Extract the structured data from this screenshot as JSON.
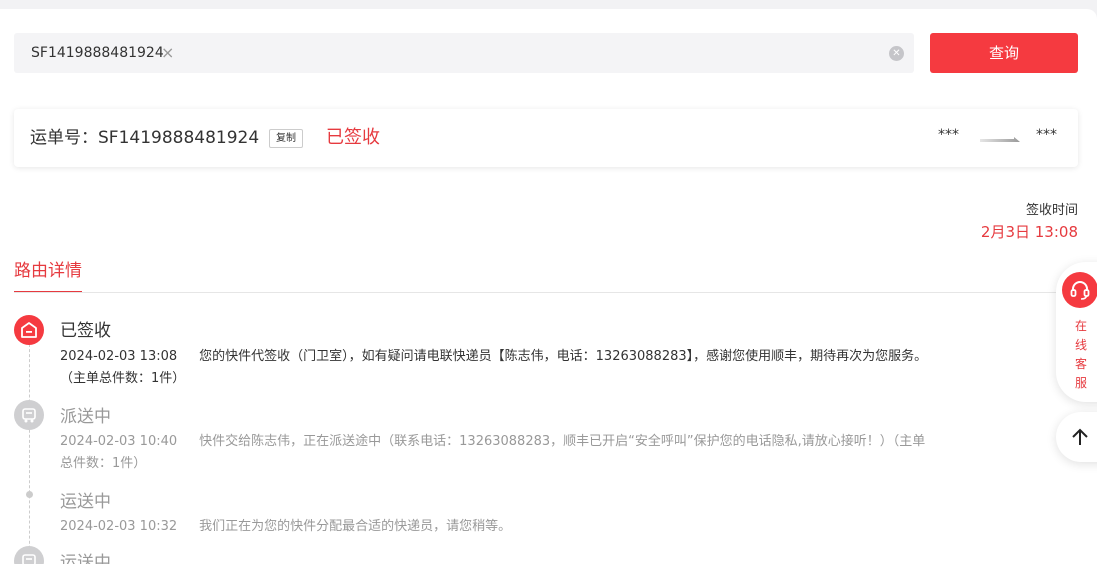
{
  "search": {
    "chip_value": "SF1419888481924",
    "query_label": "查询"
  },
  "waybill": {
    "label_prefix": "运单号：",
    "number": "SF1419888481924",
    "copy_label": "复制",
    "status": "已签收",
    "origin": "***",
    "destination": "***"
  },
  "sign_time": {
    "label": "签收时间",
    "value": "2月3日 13:08"
  },
  "tab": {
    "label": "路由详情"
  },
  "timeline": [
    {
      "title": "已签收",
      "time": "2024-02-03 13:08",
      "desc": "您的快件代签收（门卫室），如有疑问请电联快递员【陈志伟，电话：13263088283】，感谢您使用顺丰，期待再次为您服务。（主单总件数：1件）",
      "icon": "house-icon",
      "active": true
    },
    {
      "title": "派送中",
      "time": "2024-02-03 10:40",
      "desc": "快件交给陈志伟，正在派送途中（联系电话：13263088283，顺丰已开启“安全呼叫”保护您的电话隐私,请放心接听！）（主单总件数：1件）",
      "icon": "delivery-truck-icon",
      "active": false
    },
    {
      "title": "运送中",
      "time": "2024-02-03 10:32",
      "desc": "我们正在为您的快件分配最合适的快递员，请您稍等。",
      "icon": "dot-icon",
      "active": false
    },
    {
      "title": "运送中",
      "icon": "delivery-truck-icon",
      "active": false
    }
  ],
  "float": {
    "customer_service": "在线客服"
  },
  "colors": {
    "accent": "#f53a40",
    "status_red": "#e63a3f",
    "inactive_gray": "#999999"
  }
}
